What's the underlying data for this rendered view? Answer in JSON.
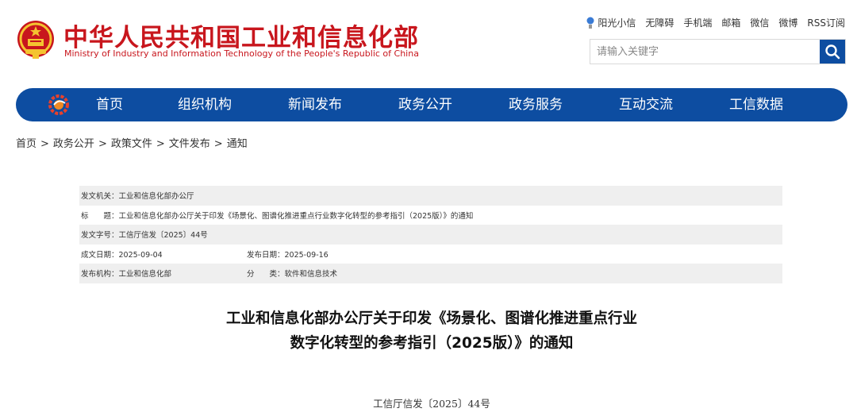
{
  "header": {
    "title": "中华人民共和国工业和信息化部",
    "subtitle": "Ministry of Industry and Information Technology of the People's Republic of China",
    "top_links": [
      "阳光小信",
      "无障碍",
      "手机端",
      "邮箱",
      "微信",
      "微博",
      "RSS订阅"
    ],
    "search": {
      "placeholder": "请输入关键字",
      "value": ""
    }
  },
  "nav": {
    "items": [
      "首页",
      "组织机构",
      "新闻发布",
      "政务公开",
      "政务服务",
      "互动交流",
      "工信数据"
    ]
  },
  "breadcrumb": [
    "首页",
    "政务公开",
    "政策文件",
    "文件发布",
    "通知"
  ],
  "breadcrumb_separator": ">",
  "meta": {
    "issuer": "发文机关：工业和信息化部办公厅",
    "title": "标　　题：工业和信息化部办公厅关于印发《场景化、图谱化推进重点行业数字化转型的参考指引（2025版）》的通知",
    "doc_number": "发文字号：工信厅信发〔2025〕44号",
    "created_date": "成文日期：2025-09-04",
    "published_date": "发布日期：2025-09-16",
    "publisher": "发布机构：工业和信息化部",
    "category": "分　　类：软件和信息技术"
  },
  "article": {
    "title_line1": "工业和信息化部办公厅关于印发《场景化、图谱化推进重点行业",
    "title_line2": "数字化转型的参考指引（2025版）》的通知",
    "doc_number": "工信厅信发〔2025〕44号"
  },
  "colors": {
    "brand_red": "#c8161d",
    "nav_blue": "#0d4da1",
    "meta_shade": "#efefef"
  },
  "icons": {
    "emblem": "national-emblem-icon",
    "search": "search-icon",
    "nav_logo": "miit-logo-icon",
    "bulb": "bulb-icon"
  }
}
